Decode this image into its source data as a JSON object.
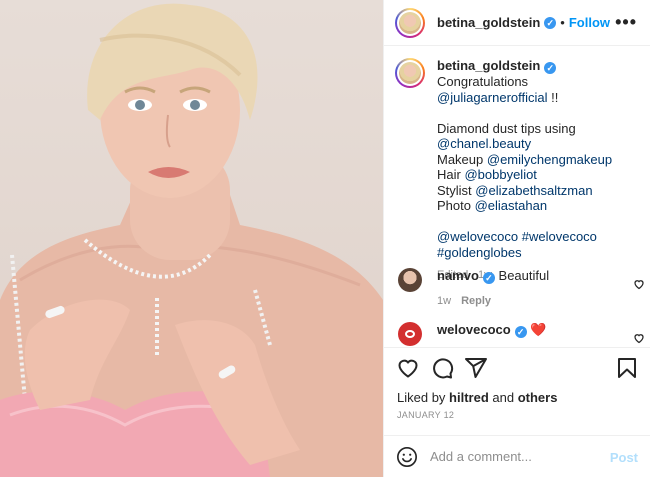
{
  "post": {
    "author": "betina_goldstein",
    "follow_label": "Follow",
    "more_label": "•••",
    "verified_glyph": "✓",
    "dot": "•"
  },
  "caption": {
    "username": "betina_goldstein",
    "line1": "Congratulations",
    "mention1": "@juliagarnerofficial",
    "exclaim": " !!",
    "line2": "Diamond dust tips using",
    "mention2": "@chanel.beauty",
    "makeup_label": "Makeup ",
    "mention3": "@emilychengmakeup",
    "hair_label": "Hair ",
    "mention4": "@bobbyeliot",
    "stylist_label": "Stylist ",
    "mention5": "@elizabethsaltzman",
    "photo_label": "Photo ",
    "mention6": "@eliastahan",
    "tag1": "@welovecoco",
    "tag2": "#welovecoco",
    "tag3": "#goldenglobes",
    "meta": "Edited · 1w"
  },
  "comments": [
    {
      "username": "namvo",
      "text": "Beautiful",
      "time": "1w",
      "reply_label": "Reply"
    },
    {
      "username": "welovecoco",
      "text": "❤️"
    }
  ],
  "likes": {
    "prefix": "Liked by ",
    "user": "hiltred",
    "middle": " and ",
    "others": "others"
  },
  "date": "JANUARY 12",
  "comment_box": {
    "placeholder": "Add a comment...",
    "post_label": "Post"
  },
  "icons": [
    "heart-icon",
    "comment-icon",
    "share-icon",
    "bookmark-icon",
    "emoji-icon",
    "more-icon",
    "verified-icon"
  ],
  "colors": {
    "link": "#00376b",
    "follow": "#0095f6",
    "verified": "#3897f0",
    "post_disabled": "#b2dffc",
    "muted": "#8e8e8e"
  }
}
